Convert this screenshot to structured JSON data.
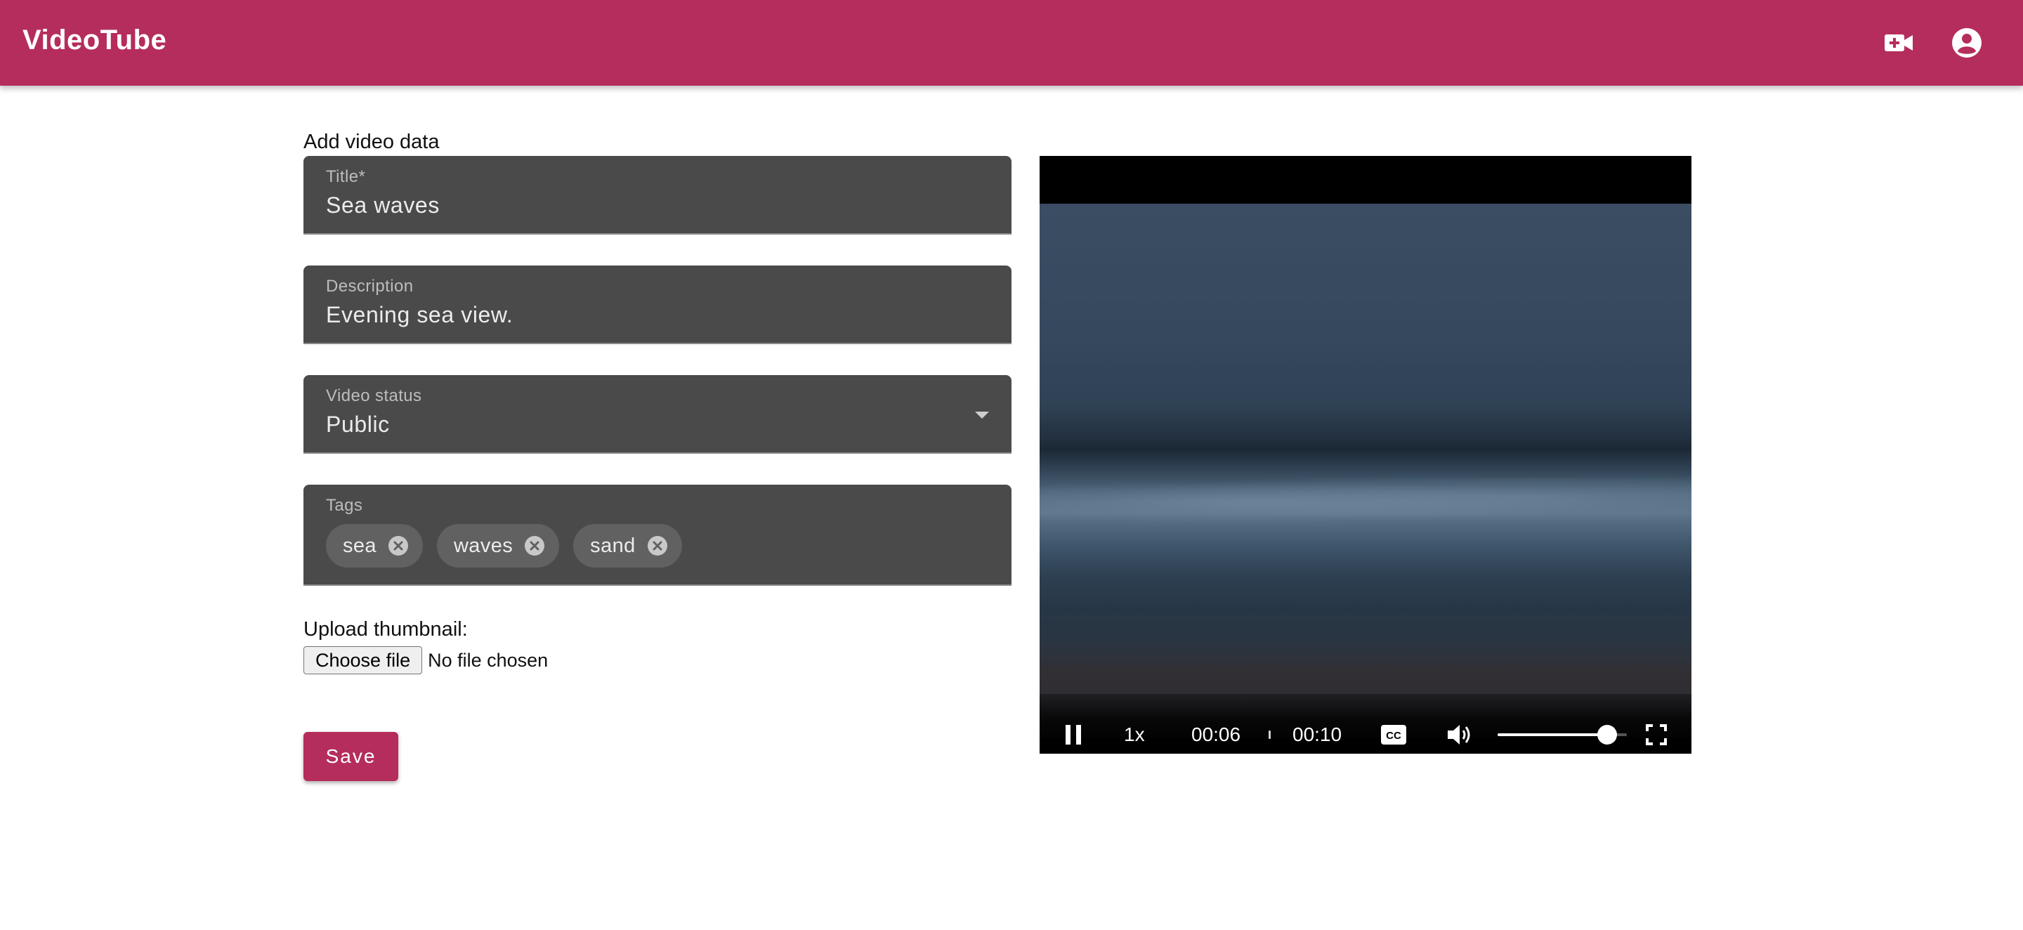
{
  "app": {
    "brand": "VideoTube",
    "accent_color": "#b52d5c",
    "icons": [
      "video-upload-icon",
      "account-circle-icon"
    ]
  },
  "form": {
    "section_label": "Add video data",
    "title": {
      "label": "Title*",
      "value": "Sea waves"
    },
    "description": {
      "label": "Description",
      "value": "Evening sea view."
    },
    "status": {
      "label": "Video status",
      "value": "Public"
    },
    "tags": {
      "label": "Tags",
      "items": [
        {
          "text": "sea"
        },
        {
          "text": "waves"
        },
        {
          "text": "sand"
        }
      ]
    },
    "upload": {
      "label": "Upload thumbnail:",
      "button": "Choose file",
      "status": "No file chosen"
    },
    "save_label": "Save"
  },
  "player": {
    "state": "playing",
    "speed": "1x",
    "current_time": "00:06",
    "duration": "00:10",
    "captions_icon": "closed-captions-icon",
    "volume_level": 1.0
  }
}
